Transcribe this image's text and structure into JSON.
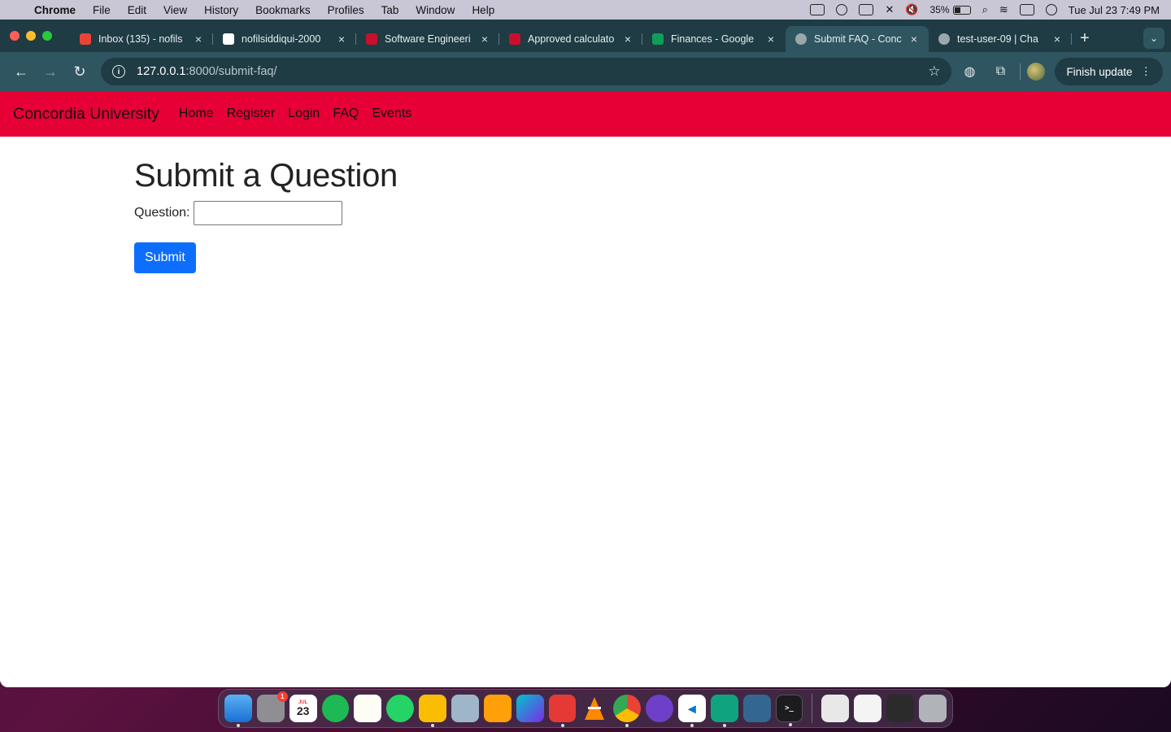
{
  "menubar": {
    "app_name": "Chrome",
    "items": [
      "File",
      "Edit",
      "View",
      "History",
      "Bookmarks",
      "Profiles",
      "Tab",
      "Window",
      "Help"
    ],
    "battery": "35%",
    "datetime": "Tue Jul 23  7:49 PM"
  },
  "browser": {
    "tabs": [
      {
        "title": "Inbox (135) - nofils",
        "favicon": "gmail-icon",
        "color": "#ea4335"
      },
      {
        "title": "nofilsiddiqui-2000",
        "favicon": "github-icon",
        "color": "#ffffff"
      },
      {
        "title": "Software Engineeri",
        "favicon": "concordia-icon",
        "color": "#c8102e"
      },
      {
        "title": "Approved calculato",
        "favicon": "concordia-icon",
        "color": "#c8102e"
      },
      {
        "title": "Finances - Google",
        "favicon": "sheets-icon",
        "color": "#0f9d58"
      },
      {
        "title": "Submit FAQ - Conc",
        "favicon": "globe-icon",
        "color": "#9aa7ab",
        "active": true
      },
      {
        "title": "test-user-09 | Cha",
        "favicon": "globe-icon",
        "color": "#9aa7ab"
      }
    ],
    "url_host": "127.0.0.1",
    "url_path": ":8000/submit-faq/",
    "finish_update": "Finish update"
  },
  "site": {
    "brand": "Concordia University",
    "nav": [
      "Home",
      "Register",
      "Login",
      "FAQ",
      "Events"
    ],
    "accent": "#e60035"
  },
  "form": {
    "title": "Submit a Question",
    "question_label": "Question:",
    "question_value": "",
    "submit_label": "Submit"
  },
  "dock": {
    "calendar_day": "23",
    "calendar_month": "JUL",
    "settings_badge": "1"
  }
}
